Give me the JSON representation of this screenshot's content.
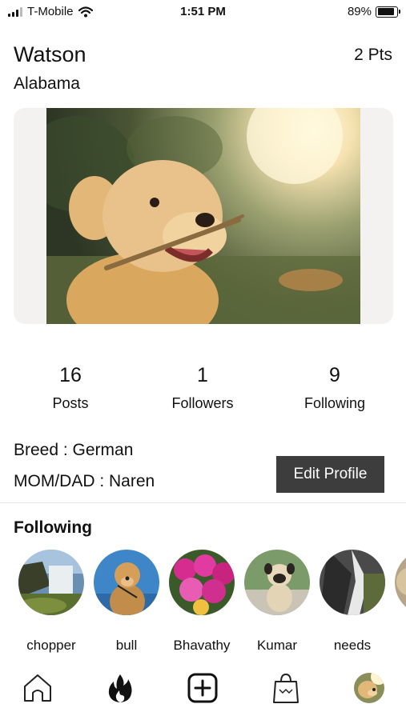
{
  "status_bar": {
    "carrier": "T-Mobile",
    "time": "1:51 PM",
    "battery_percent": "89%",
    "battery_level": 0.89,
    "icons": [
      "signal-icon",
      "wifi-icon",
      "battery-icon"
    ]
  },
  "profile": {
    "name": "Watson",
    "points": "2 Pts",
    "location": "Alabama",
    "photo": "golden-retriever-with-stick-photo"
  },
  "stats": [
    {
      "value": "16",
      "label": "Posts"
    },
    {
      "value": "1",
      "label": "Followers"
    },
    {
      "value": "9",
      "label": "Following"
    }
  ],
  "info": {
    "breed": "Breed : German",
    "parent": "MOM/DAD : Naren",
    "edit_button": "Edit Profile"
  },
  "following": {
    "title": "Following",
    "items": [
      {
        "name": "chopper",
        "image": "waterfall-photo"
      },
      {
        "name": "bull",
        "image": "golden-retriever-photo"
      },
      {
        "name": "Bhavathy",
        "image": "pink-flowers-photo"
      },
      {
        "name": "Kumar",
        "image": "pug-photo"
      },
      {
        "name": "needs",
        "image": "waterfall-bw-photo"
      }
    ]
  },
  "bottom_nav": {
    "items": [
      "home-icon",
      "flame-icon",
      "add-post-icon",
      "shop-bag-icon",
      "profile-avatar-icon"
    ]
  },
  "colors": {
    "button_bg": "#3d3d3d",
    "card_bg": "#f4f1f1",
    "text": "#111111"
  }
}
